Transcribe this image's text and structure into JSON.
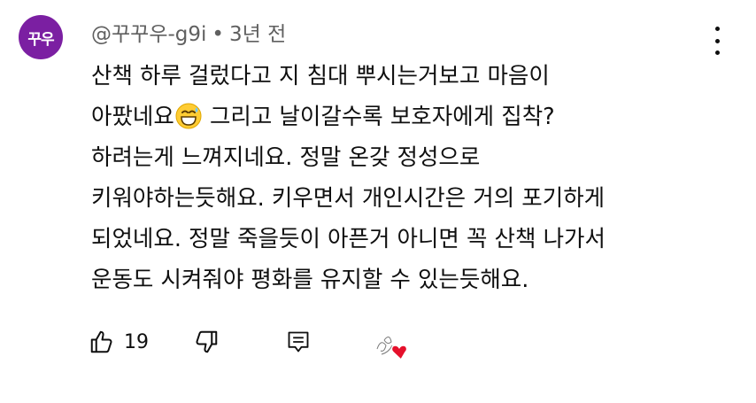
{
  "author": {
    "avatar_text": "꾸우",
    "avatar_color": "#7b1fa2",
    "handle": "@꾸꾸우-g9i",
    "separator": "•",
    "posted_time": "3년 전"
  },
  "comment": {
    "lines": [
      "산책 하루 걸렀다고 지 침대 뿌시는거보고 마음이",
      "아팠네요",
      " 그리고 날이갈수록 보호자에게 집착?",
      "하려는게 느껴지네요. 정말 온갖 정성으로",
      "키워야하는듯해요. 키우면서 개인시간은 거의 포기하게",
      "되었네요. 정말 죽을듯이 아픈거 아니면 꼭 산책 나가서",
      "운동도 시켜줘야 평화를 유지할 수 있는듯해요."
    ],
    "emoji": "grinning-sweat-emoji"
  },
  "actions": {
    "like_count": "19",
    "like_icon": "thumbs-up-icon",
    "dislike_icon": "thumbs-down-icon",
    "reply_icon": "reply-icon",
    "creator_heart": "creator-heart-icon",
    "heart_color": "#e5102b"
  },
  "menu_icon": "more-vert-icon"
}
